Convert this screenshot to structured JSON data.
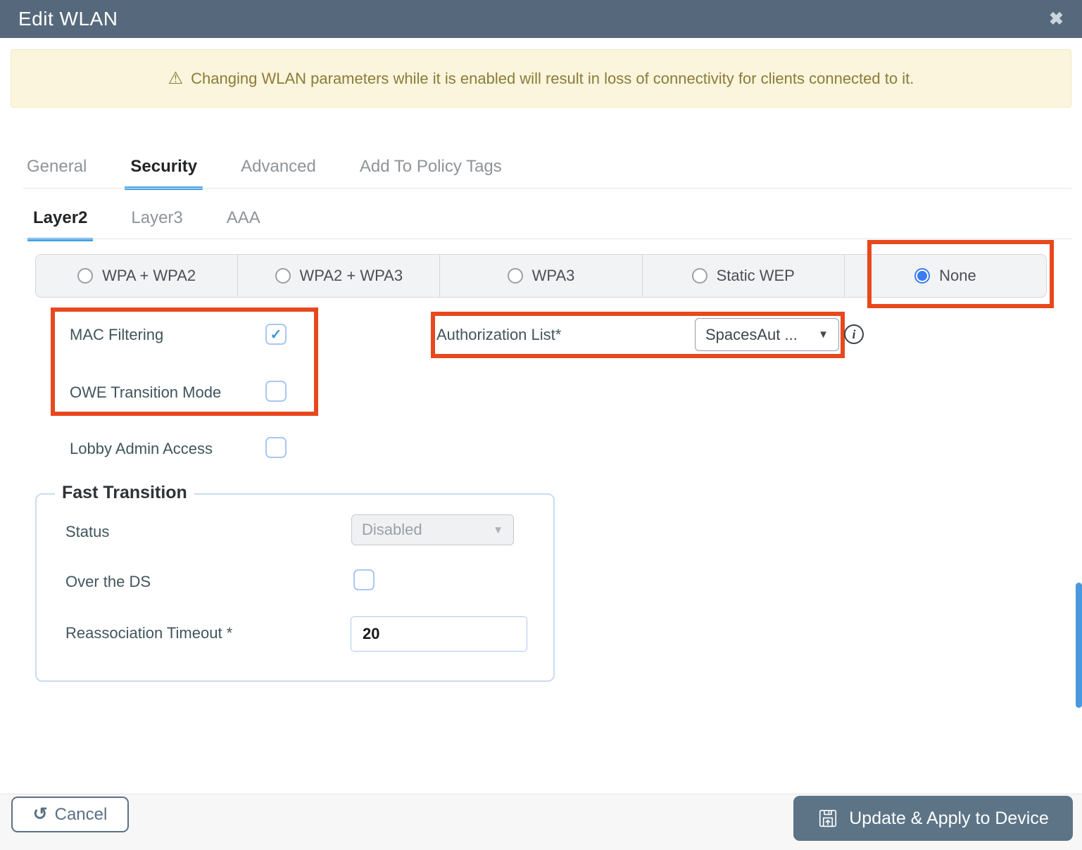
{
  "titlebar": {
    "title": "Edit WLAN"
  },
  "warning_banner": {
    "text": "Changing WLAN parameters while it is enabled will result in loss of connectivity for clients connected to it."
  },
  "tabs": [
    {
      "label": "General",
      "active": false
    },
    {
      "label": "Security",
      "active": true
    },
    {
      "label": "Advanced",
      "active": false
    },
    {
      "label": "Add To Policy Tags",
      "active": false
    }
  ],
  "subtabs": [
    {
      "label": "Layer2",
      "active": true
    },
    {
      "label": "Layer3",
      "active": false
    },
    {
      "label": "AAA",
      "active": false
    }
  ],
  "security_modes": {
    "options": [
      {
        "label": "WPA + WPA2",
        "selected": false
      },
      {
        "label": "WPA2 + WPA3",
        "selected": false
      },
      {
        "label": "WPA3",
        "selected": false
      },
      {
        "label": "Static WEP",
        "selected": false
      },
      {
        "label": "None",
        "selected": true
      }
    ]
  },
  "form": {
    "mac_filtering": {
      "label": "MAC Filtering",
      "checked": true
    },
    "owe_transition": {
      "label": "OWE Transition Mode",
      "checked": false
    },
    "lobby_admin": {
      "label": "Lobby Admin Access",
      "checked": false
    },
    "authorization_list": {
      "label": "Authorization List*",
      "value": "SpacesAut ..."
    }
  },
  "fast_transition": {
    "legend": "Fast Transition",
    "status": {
      "label": "Status",
      "value": "Disabled",
      "disabled": true
    },
    "over_the_ds": {
      "label": "Over the DS",
      "checked": false
    },
    "reassociation_timeout": {
      "label": "Reassociation Timeout *",
      "value": "20"
    }
  },
  "footer": {
    "cancel_label": "Cancel",
    "update_label": "Update & Apply to Device"
  },
  "icons": {
    "close": "✖",
    "warning": "⚠",
    "check": "✓",
    "dropdown_arrow": "▼",
    "info": "i",
    "undo": "↺"
  },
  "colors": {
    "titlebar_bg": "#56697c",
    "accent_blue": "#42a0e8",
    "selected_radio_blue": "#3b7cf0",
    "annotation_red": "#e7481d",
    "warning_bg": "#faf5dc",
    "warning_text": "#8c7b3a",
    "primary_button_bg": "#5c7486",
    "scrollbar_thumb": "#4a98dd"
  }
}
